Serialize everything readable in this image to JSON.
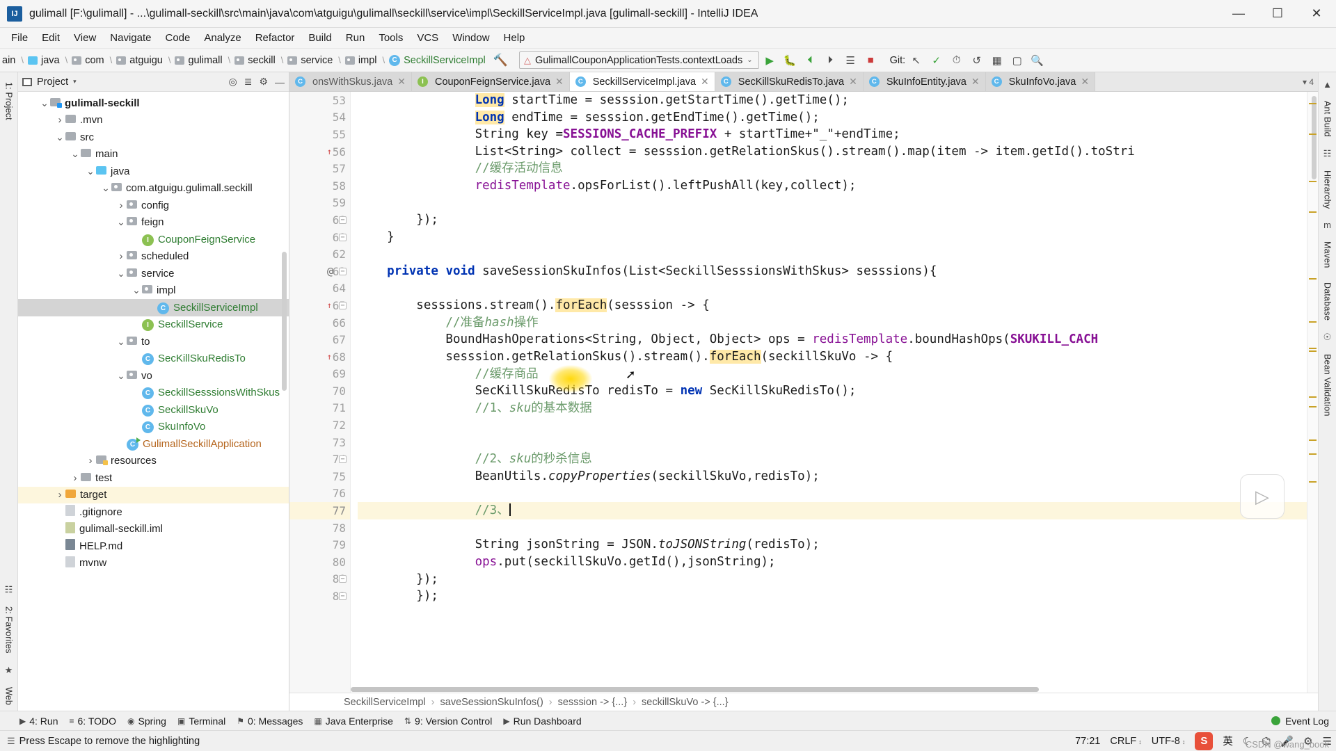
{
  "window": {
    "title": "gulimall [F:\\gulimall] - ...\\gulimall-seckill\\src\\main\\java\\com\\atguigu\\gulimall\\seckill\\service\\impl\\SeckillServiceImpl.java [gulimall-seckill] - IntelliJ IDEA",
    "app_icon": "intellij-idea-icon",
    "minimize": "—",
    "maximize": "☐",
    "close": "✕"
  },
  "menubar": {
    "items": [
      "File",
      "Edit",
      "View",
      "Navigate",
      "Code",
      "Analyze",
      "Refactor",
      "Build",
      "Run",
      "Tools",
      "VCS",
      "Window",
      "Help"
    ]
  },
  "navbar": {
    "crumbs": [
      {
        "label": "ain",
        "icon": "none"
      },
      {
        "label": "java",
        "icon": "folder-blue"
      },
      {
        "label": "com",
        "icon": "package"
      },
      {
        "label": "atguigu",
        "icon": "package"
      },
      {
        "label": "gulimall",
        "icon": "package"
      },
      {
        "label": "seckill",
        "icon": "package"
      },
      {
        "label": "service",
        "icon": "package"
      },
      {
        "label": "impl",
        "icon": "package"
      },
      {
        "label": "SeckillServiceImpl",
        "icon": "class",
        "green": true
      }
    ],
    "hammer_icon": "build-hammer-icon",
    "run_config": "GulimallCouponApplicationTests.contextLoads",
    "run_config_caret": "⌄",
    "buttons": [
      "run-icon",
      "debug-icon",
      "run-with-coverage-icon",
      "profile-icon",
      "stop-icon"
    ],
    "git_label": "Git:",
    "git_buttons": [
      "update-project-icon",
      "commit-icon",
      "history-icon",
      "rollback-icon",
      "search-everywhere-icon"
    ]
  },
  "left_rail": {
    "tabs": [
      "1: Project",
      "2: Favorites",
      "Web"
    ],
    "icons": [
      "structure-icon",
      "star-icon"
    ]
  },
  "right_rail": {
    "tabs": [
      "Ant Build",
      "Hierarchy",
      "Maven",
      "Database",
      "Bean Validation"
    ]
  },
  "project_panel": {
    "title": "Project",
    "caret": "▾",
    "actions": [
      "locate-icon",
      "collapse-all-icon",
      "settings-icon",
      "hide-icon"
    ],
    "tree": [
      {
        "depth": 1,
        "arrow": "v",
        "icon": "module",
        "label": "gulimall-seckill",
        "bold": true
      },
      {
        "depth": 2,
        "arrow": ">",
        "icon": "folder",
        "label": ".mvn"
      },
      {
        "depth": 2,
        "arrow": "v",
        "icon": "folder",
        "label": "src"
      },
      {
        "depth": 3,
        "arrow": "v",
        "icon": "folder",
        "label": "main"
      },
      {
        "depth": 4,
        "arrow": "v",
        "icon": "folder-blue",
        "label": "java"
      },
      {
        "depth": 5,
        "arrow": "v",
        "icon": "package",
        "label": "com.atguigu.gulimall.seckill"
      },
      {
        "depth": 6,
        "arrow": ">",
        "icon": "package",
        "label": "config"
      },
      {
        "depth": 6,
        "arrow": "v",
        "icon": "package",
        "label": "feign"
      },
      {
        "depth": 7,
        "arrow": "",
        "icon": "interface",
        "label": "CouponFeignService",
        "green": true
      },
      {
        "depth": 6,
        "arrow": ">",
        "icon": "package",
        "label": "scheduled"
      },
      {
        "depth": 6,
        "arrow": "v",
        "icon": "package",
        "label": "service"
      },
      {
        "depth": 7,
        "arrow": "v",
        "icon": "package",
        "label": "impl"
      },
      {
        "depth": 8,
        "arrow": "",
        "icon": "class",
        "label": "SeckillServiceImpl",
        "green": true,
        "selected": true
      },
      {
        "depth": 7,
        "arrow": "",
        "icon": "interface",
        "label": "SeckillService",
        "green": true
      },
      {
        "depth": 6,
        "arrow": "v",
        "icon": "package",
        "label": "to"
      },
      {
        "depth": 7,
        "arrow": "",
        "icon": "class",
        "label": "SecKillSkuRedisTo",
        "green": true
      },
      {
        "depth": 6,
        "arrow": "v",
        "icon": "package",
        "label": "vo"
      },
      {
        "depth": 7,
        "arrow": "",
        "icon": "class",
        "label": "SeckillSesssionsWithSkus",
        "green": true
      },
      {
        "depth": 7,
        "arrow": "",
        "icon": "class",
        "label": "SeckillSkuVo",
        "green": true
      },
      {
        "depth": 7,
        "arrow": "",
        "icon": "class",
        "label": "SkuInfoVo",
        "green": true
      },
      {
        "depth": 6,
        "arrow": "",
        "icon": "application-class",
        "label": "GulimallSeckillApplication",
        "orange": true
      },
      {
        "depth": 4,
        "arrow": ">",
        "icon": "folder-resources",
        "label": "resources"
      },
      {
        "depth": 3,
        "arrow": ">",
        "icon": "folder",
        "label": "test"
      },
      {
        "depth": 2,
        "arrow": ">",
        "icon": "folder-orange",
        "label": "target",
        "highlight": true
      },
      {
        "depth": 2,
        "arrow": "",
        "icon": "file",
        "label": ".gitignore"
      },
      {
        "depth": 2,
        "arrow": "",
        "icon": "file-xml",
        "label": "gulimall-seckill.iml"
      },
      {
        "depth": 2,
        "arrow": "",
        "icon": "file-md",
        "label": "HELP.md"
      },
      {
        "depth": 2,
        "arrow": "",
        "icon": "file",
        "label": "mvnw"
      }
    ]
  },
  "editor": {
    "tabs": [
      {
        "label": "onsWithSkus.java",
        "icon": "class",
        "active": false,
        "dim": true
      },
      {
        "label": "CouponFeignService.java",
        "icon": "interface",
        "active": false
      },
      {
        "label": "SeckillServiceImpl.java",
        "icon": "class",
        "active": true
      },
      {
        "label": "SecKillSkuRedisTo.java",
        "icon": "class",
        "active": false
      },
      {
        "label": "SkuInfoEntity.java",
        "icon": "class",
        "active": false
      },
      {
        "label": "SkuInfoVo.java",
        "icon": "class",
        "active": false
      }
    ],
    "tab_overflow": "▾ 4",
    "close_icon": "✕",
    "first_line_number": 53,
    "lines": [
      {
        "n": 53,
        "fold": "",
        "mark": "",
        "tokens": [
          {
            "t": "                ",
            "c": ""
          },
          {
            "t": "Long",
            "c": "kw hl-y"
          },
          {
            "t": " startTime = sesssion.getStartTime().getTime();",
            "c": ""
          }
        ]
      },
      {
        "n": 54,
        "fold": "",
        "mark": "",
        "tokens": [
          {
            "t": "                ",
            "c": ""
          },
          {
            "t": "Long",
            "c": "kw hl-y"
          },
          {
            "t": " endTime = sesssion.getEndTime().getTime();",
            "c": ""
          }
        ]
      },
      {
        "n": 55,
        "fold": "",
        "mark": "",
        "tokens": [
          {
            "t": "                String key =",
            "c": ""
          },
          {
            "t": "SESSIONS_CACHE_PREFIX",
            "c": "cnst"
          },
          {
            "t": " + startTime+",
            "c": ""
          },
          {
            "t": "\"_\"",
            "c": ""
          },
          {
            "t": "+endTime;",
            "c": ""
          }
        ]
      },
      {
        "n": 56,
        "fold": "",
        "mark": "warn",
        "tokens": [
          {
            "t": "                List<String> collect = sesssion.getRelationSkus().stream().map(item -> item.getId().toStri",
            "c": ""
          }
        ]
      },
      {
        "n": 57,
        "fold": "",
        "mark": "",
        "tokens": [
          {
            "t": "                //缓存活动信息",
            "c": "cmt-zh"
          }
        ]
      },
      {
        "n": 58,
        "fold": "",
        "mark": "",
        "tokens": [
          {
            "t": "                ",
            "c": ""
          },
          {
            "t": "redisTemplate",
            "c": "fld"
          },
          {
            "t": ".opsForList().leftPushAll(key,collect);",
            "c": ""
          }
        ]
      },
      {
        "n": 59,
        "fold": "",
        "mark": "",
        "tokens": []
      },
      {
        "n": 60,
        "fold": "-",
        "mark": "",
        "tokens": [
          {
            "t": "        });",
            "c": ""
          }
        ]
      },
      {
        "n": 61,
        "fold": "-",
        "mark": "",
        "tokens": [
          {
            "t": "    }",
            "c": ""
          }
        ]
      },
      {
        "n": 62,
        "fold": "",
        "mark": "",
        "tokens": []
      },
      {
        "n": 63,
        "fold": "-",
        "mark": "at",
        "tokens": [
          {
            "t": "    ",
            "c": ""
          },
          {
            "t": "private",
            "c": "kw"
          },
          {
            "t": " ",
            "c": ""
          },
          {
            "t": "void",
            "c": "kw"
          },
          {
            "t": " saveSessionSkuInfos(List<SeckillSesssionsWithSkus> sesssions){",
            "c": ""
          }
        ]
      },
      {
        "n": 64,
        "fold": "",
        "mark": "",
        "tokens": []
      },
      {
        "n": 65,
        "fold": "-",
        "mark": "warn",
        "tokens": [
          {
            "t": "        sesssions.stream().",
            "c": ""
          },
          {
            "t": "forEach",
            "c": "hl-y"
          },
          {
            "t": "(sesssion -> {",
            "c": ""
          }
        ]
      },
      {
        "n": 66,
        "fold": "",
        "mark": "",
        "tokens": [
          {
            "t": "            //准备",
            "c": "cmt-zh"
          },
          {
            "t": "hash",
            "c": "cmt-zh cmt-it"
          },
          {
            "t": "操作",
            "c": "cmt-zh"
          }
        ]
      },
      {
        "n": 67,
        "fold": "",
        "mark": "",
        "tokens": [
          {
            "t": "            BoundHashOperations<String, Object, Object> ops = ",
            "c": ""
          },
          {
            "t": "redisTemplate",
            "c": "fld"
          },
          {
            "t": ".boundHashOps(",
            "c": ""
          },
          {
            "t": "SKUKILL_CACH",
            "c": "cnst"
          }
        ]
      },
      {
        "n": 68,
        "fold": "",
        "mark": "warn",
        "tokens": [
          {
            "t": "            sesssion.getRelationSkus().stream().",
            "c": ""
          },
          {
            "t": "forEach",
            "c": "hl-y"
          },
          {
            "t": "(seckillSkuVo -> {",
            "c": ""
          }
        ]
      },
      {
        "n": 69,
        "fold": "",
        "mark": "",
        "tokens": [
          {
            "t": "                //缓存商品",
            "c": "cmt-zh"
          }
        ]
      },
      {
        "n": 70,
        "fold": "",
        "mark": "",
        "tokens": [
          {
            "t": "                SecKillSkuRedisTo redisTo = ",
            "c": ""
          },
          {
            "t": "new",
            "c": "kw"
          },
          {
            "t": " SecKillSkuRedisTo();",
            "c": ""
          }
        ]
      },
      {
        "n": 71,
        "fold": "",
        "mark": "",
        "tokens": [
          {
            "t": "                //1、",
            "c": "cmt-zh"
          },
          {
            "t": "sku",
            "c": "cmt-zh cmt-it"
          },
          {
            "t": "的基本数据",
            "c": "cmt-zh"
          }
        ]
      },
      {
        "n": 72,
        "fold": "",
        "mark": "",
        "tokens": []
      },
      {
        "n": 73,
        "fold": "",
        "mark": "",
        "tokens": []
      },
      {
        "n": 74,
        "fold": "-",
        "mark": "",
        "tokens": [
          {
            "t": "                //2、",
            "c": "cmt-zh"
          },
          {
            "t": "sku",
            "c": "cmt-zh cmt-it"
          },
          {
            "t": "的秒杀信息",
            "c": "cmt-zh"
          }
        ]
      },
      {
        "n": 75,
        "fold": "",
        "mark": "",
        "tokens": [
          {
            "t": "                BeanUtils.",
            "c": ""
          },
          {
            "t": "copyProperties",
            "c": "cmt-it"
          },
          {
            "t": "(seckillSkuVo,redisTo);",
            "c": ""
          }
        ]
      },
      {
        "n": 76,
        "fold": "",
        "mark": "",
        "tokens": []
      },
      {
        "n": 77,
        "fold": "",
        "mark": "",
        "current": true,
        "tokens": [
          {
            "t": "                //3、",
            "c": "cmt-zh"
          }
        ]
      },
      {
        "n": 78,
        "fold": "",
        "mark": "",
        "tokens": []
      },
      {
        "n": 79,
        "fold": "",
        "mark": "",
        "tokens": [
          {
            "t": "                String jsonString = JSON.",
            "c": ""
          },
          {
            "t": "toJSONString",
            "c": "cmt-it"
          },
          {
            "t": "(redisTo);",
            "c": ""
          }
        ]
      },
      {
        "n": 80,
        "fold": "",
        "mark": "",
        "tokens": [
          {
            "t": "                ",
            "c": ""
          },
          {
            "t": "ops",
            "c": "fld"
          },
          {
            "t": ".put(seckillSkuVo.getId(),jsonString);",
            "c": ""
          }
        ]
      },
      {
        "n": 81,
        "fold": "-",
        "mark": "",
        "tokens": [
          {
            "t": "        });",
            "c": ""
          }
        ]
      },
      {
        "n": 82,
        "fold": "-",
        "mark": "",
        "tokens": [
          {
            "t": "        });",
            "c": ""
          }
        ]
      }
    ],
    "breadcrumbs": [
      "SeckillServiceImpl",
      "saveSessionSkuInfos()",
      "sesssion -> {...}",
      "seckillSkuVo -> {...}"
    ],
    "breadcrumb_sep": "›"
  },
  "toolwindows": {
    "items": [
      {
        "label": "4: Run",
        "icon": "run-icon"
      },
      {
        "label": "6: TODO",
        "icon": "todo-icon"
      },
      {
        "label": "Spring",
        "icon": "spring-icon"
      },
      {
        "label": "Terminal",
        "icon": "terminal-icon"
      },
      {
        "label": "0: Messages",
        "icon": "messages-icon"
      },
      {
        "label": "Java Enterprise",
        "icon": "java-enterprise-icon"
      },
      {
        "label": "9: Version Control",
        "icon": "version-control-icon"
      },
      {
        "label": "Run Dashboard",
        "icon": "run-dashboard-icon"
      }
    ],
    "event_log": "Event Log"
  },
  "statusbar": {
    "message": "Press Escape to remove the highlighting",
    "caret_position": "77:21",
    "line_separator": "CRLF",
    "encoding": "UTF-8",
    "ime_badge": "S",
    "ime_mode": "英",
    "icons": [
      "ime-moon-icon",
      "ime-keyboard-icon",
      "ime-mic-icon",
      "ime-tools-icon",
      "ime-menu-icon"
    ],
    "caret_glyph": "↕"
  },
  "watermark": "CSDN @wang_book",
  "video_badge_icon": "play-icon",
  "colors": {
    "accent_green": "#2f7d32",
    "keyword_blue": "#0033b3",
    "constant_purple": "#871094",
    "highlight_yellow": "#fdf6dd",
    "selection_gray": "#d4d4d4",
    "cursor_glow": "#ffd600"
  }
}
